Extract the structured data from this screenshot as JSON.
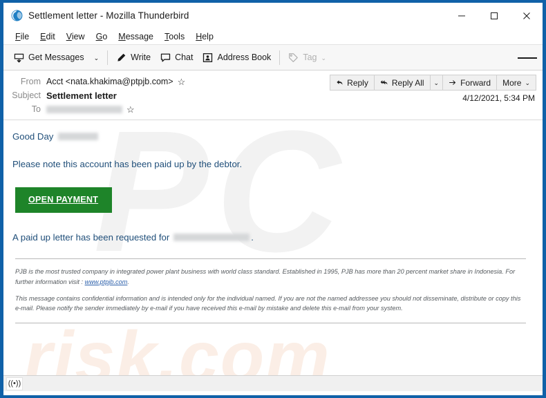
{
  "window": {
    "title": "Settlement letter - Mozilla Thunderbird",
    "app_icon": "thunderbird-icon",
    "controls": {
      "minimize": "—",
      "maximize": "☐",
      "close": "✕"
    }
  },
  "menubar": {
    "items": [
      {
        "label": "File",
        "accel": "F"
      },
      {
        "label": "Edit",
        "accel": "E"
      },
      {
        "label": "View",
        "accel": "V"
      },
      {
        "label": "Go",
        "accel": "G"
      },
      {
        "label": "Message",
        "accel": "M"
      },
      {
        "label": "Tools",
        "accel": "T"
      },
      {
        "label": "Help",
        "accel": "H"
      }
    ]
  },
  "toolbar": {
    "get_messages": "Get Messages",
    "write": "Write",
    "chat": "Chat",
    "address_book": "Address Book",
    "tag": "Tag",
    "caret": "⌄",
    "app_menu": "app-menu-button"
  },
  "message_header": {
    "from_label": "From",
    "from_value": "Acct <nata.khakima@ptpjb.com>",
    "subject_label": "Subject",
    "subject_value": "Settlement letter",
    "to_label": "To",
    "to_value_redacted": true,
    "star": "☆",
    "date": "4/12/2021, 5:34 PM",
    "actions": {
      "reply": "Reply",
      "reply_all": "Reply All",
      "forward": "Forward",
      "more": "More"
    }
  },
  "body": {
    "greeting_prefix": "Good Day",
    "greeting_redacted": true,
    "paragraph_1": "Please note this account has been paid up by the debtor.",
    "cta_label": "OPEN PAYMENT",
    "paragraph_2_prefix": "A paid up letter has been requested for",
    "paragraph_2_suffix": ".",
    "paragraph_2_redacted": true,
    "footer_1_prefix": "PJB is the most trusted company in integrated power plant business with world class standard. Established in 1995, PJB has more than 20 percent market share in Indonesia. For further information visit : ",
    "footer_1_link": "www.ptpjb.com",
    "footer_1_suffix": ".",
    "footer_2": "This message contains confidential information and is intended only for the individual named. If you are not the named addressee you should not disseminate, distribute or copy this e-mail. Please notify the sender immediately by e-mail if you have received this e-mail by mistake and delete this e-mail from your system.",
    "watermark_top": "PC",
    "watermark_bottom": "risk.com"
  },
  "statusbar": {
    "icon": "broadcast-icon",
    "icon_glyph": "((•))"
  },
  "colors": {
    "window_border": "#1061a8",
    "body_text": "#1f4e79",
    "cta_background": "#1e8429",
    "link": "#2b5faa",
    "toolbar_background": "#f7f7f7"
  }
}
